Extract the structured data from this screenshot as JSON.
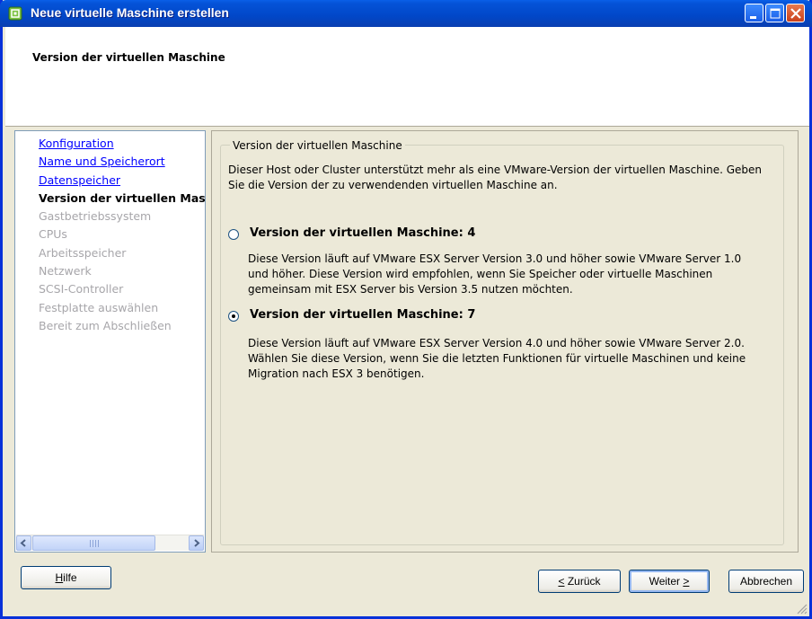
{
  "window": {
    "title": "Neue virtuelle Maschine erstellen"
  },
  "header": {
    "title": "Version der virtuellen Maschine"
  },
  "nav": {
    "items": [
      {
        "label": "Konfiguration",
        "state": "link"
      },
      {
        "label": "Name und Speicherort",
        "state": "link"
      },
      {
        "label": "Datenspeicher",
        "state": "link"
      },
      {
        "label": "Version der virtuellen Mas",
        "state": "current"
      },
      {
        "label": "Gastbetriebssystem",
        "state": "disabled"
      },
      {
        "label": "CPUs",
        "state": "disabled"
      },
      {
        "label": "Arbeitsspeicher",
        "state": "disabled"
      },
      {
        "label": "Netzwerk",
        "state": "disabled"
      },
      {
        "label": "SCSI-Controller",
        "state": "disabled"
      },
      {
        "label": "Festplatte auswählen",
        "state": "disabled"
      },
      {
        "label": "Bereit zum Abschließen",
        "state": "disabled"
      }
    ]
  },
  "content": {
    "group_title": "Version der virtuellen Maschine",
    "intro": "Dieser Host oder Cluster unterstützt mehr als eine VMware-Version der virtuellen Maschine. Geben Sie die Version der zu verwendenden virtuellen Maschine an.",
    "options": [
      {
        "label": "Version der virtuellen Maschine: 4",
        "selected": false,
        "description": "Diese Version läuft auf VMware ESX Server Version 3.0 und höher sowie VMware Server 1.0 und höher. Diese Version wird empfohlen, wenn Sie Speicher oder virtuelle Maschinen gemeinsam mit ESX Server bis Version 3.5 nutzen möchten."
      },
      {
        "label": "Version der virtuellen Maschine: 7",
        "selected": true,
        "description": "Diese Version läuft auf VMware ESX Server Version 4.0 und höher sowie VMware Server 2.0. Wählen Sie diese Version, wenn Sie die letzten Funktionen für virtuelle Maschinen und keine Migration nach ESX 3 benötigen."
      }
    ]
  },
  "buttons": {
    "help": {
      "mnemonic": "H",
      "rest": "ilfe"
    },
    "back": {
      "mnemonic": "<",
      "rest": " Zurück"
    },
    "next": {
      "text": "Weiter ",
      "mnemonic": ">"
    },
    "cancel": "Abbrechen"
  },
  "colors": {
    "titlebar": "#0553d8",
    "link": "#0000ff",
    "disabled_text": "#a7a6aa",
    "window_bg": "#ece9d8"
  }
}
